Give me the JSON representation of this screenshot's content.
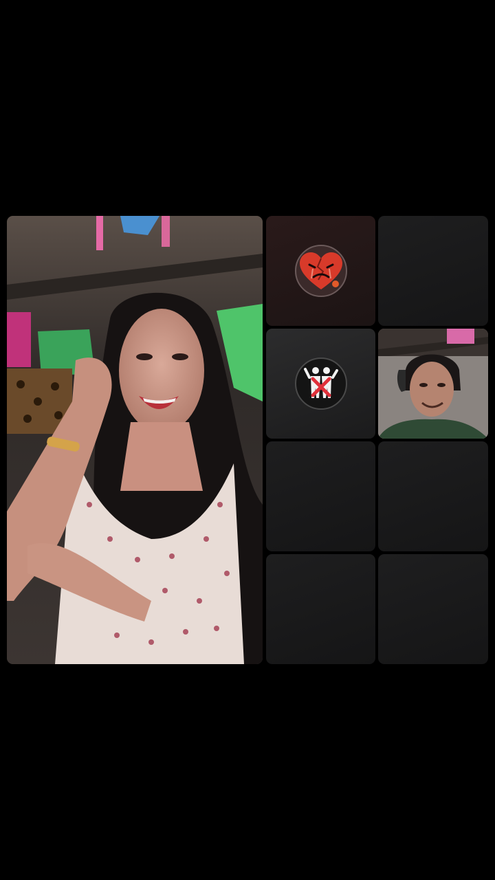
{
  "call": {
    "layout": "multi-guest-live-grid",
    "participants": [
      {
        "slot": "host",
        "type": "video",
        "description_icon": "person-video"
      },
      {
        "slot": "guest-1",
        "type": "badge",
        "icon": "broken-heart-badge-icon"
      },
      {
        "slot": "guest-2",
        "type": "empty"
      },
      {
        "slot": "guest-3",
        "type": "badge",
        "icon": "no-couple-badge-icon"
      },
      {
        "slot": "guest-4",
        "type": "video",
        "description_icon": "person-video"
      },
      {
        "slot": "guest-5",
        "type": "empty"
      },
      {
        "slot": "guest-6",
        "type": "empty"
      },
      {
        "slot": "guest-7",
        "type": "empty"
      },
      {
        "slot": "guest-8",
        "type": "empty"
      }
    ]
  },
  "colors": {
    "background": "#000000",
    "empty_tile": "#1a1a1b",
    "badge_red": "#d83a2a",
    "badge_cross": "#e0303a"
  }
}
